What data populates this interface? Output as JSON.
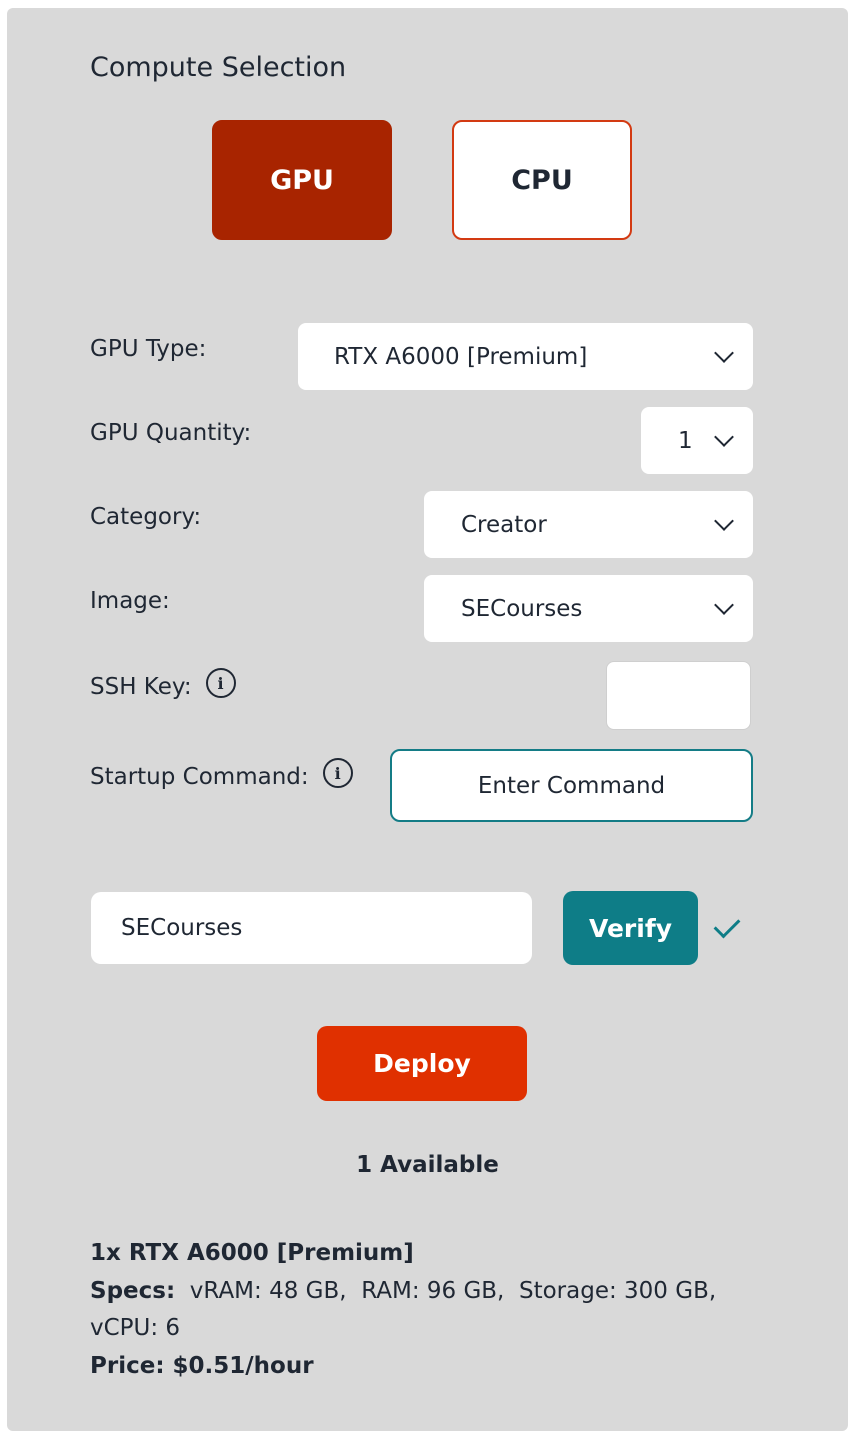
{
  "section": {
    "title": "Compute Selection"
  },
  "toggle": {
    "gpu_label": "GPU",
    "cpu_label": "CPU",
    "selected": "GPU"
  },
  "form": {
    "gpu_type": {
      "label": "GPU Type:",
      "value": "RTX A6000 [Premium]"
    },
    "gpu_quantity": {
      "label": "GPU Quantity:",
      "value": "1"
    },
    "category": {
      "label": "Category:",
      "value": "Creator"
    },
    "image": {
      "label": "Image:",
      "value": "SECourses"
    },
    "ssh_key": {
      "label": "SSH Key:",
      "value": ""
    },
    "startup_command": {
      "label": "Startup Command:",
      "button_label": "Enter Command"
    }
  },
  "token": {
    "value": "SECourses",
    "verify_label": "Verify",
    "verified": true
  },
  "deploy": {
    "label": "Deploy"
  },
  "availability": "1 Available",
  "summary": {
    "title": "1x RTX A6000 [Premium]",
    "specs_label": "Specs:",
    "specs_line1": "vRAM: 48 GB,  RAM: 96 GB,  Storage: 300 GB,",
    "specs_line2": "vCPU: 6",
    "price": "Price: $0.51/hour"
  },
  "colors": {
    "panel_bg": "#d9d9d9",
    "gpu_selected": "#a82400",
    "cpu_border": "#d33a12",
    "teal": "#0e7d87",
    "deploy": "#e03000",
    "text": "#1f2733"
  }
}
